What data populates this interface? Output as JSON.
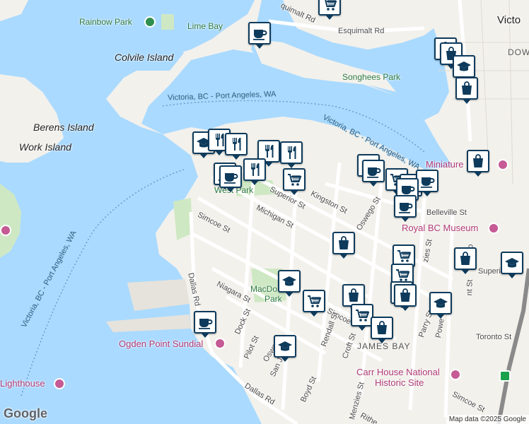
{
  "map": {
    "places": {
      "colvile": "Colvile Island",
      "berens": "Berens Island",
      "work": "Work Island",
      "victoria": "Victo",
      "downtown": "DOW",
      "james_bay": "JAMES BAY"
    },
    "parks": {
      "rainbow": "Rainbow Park",
      "lime_bay": "Lime Bay",
      "songhees": "Songhees Park",
      "west_park": "West Park",
      "macdonald": "MacDo",
      "macdonald2": "Park"
    },
    "pois": {
      "miniature": "Miniature",
      "royal_bc": "Royal BC Museum",
      "ogden": "Ogden Point Sundial",
      "carr_house_1": "Carr House National",
      "carr_house_2": "Historic Site",
      "lighthouse": "Lighthouse"
    },
    "water": {
      "route_top": "Victoria, BC - Port Angeles, WA",
      "route_right": "Victoria, BC - Port Angeles, WA",
      "route_left": "Victoria, BC - Port Angeles, WA"
    },
    "streets": {
      "esquimalt_rd": "Esquimalt Rd",
      "esquimalt_top": "quimalt Rd",
      "superior": "Superior St",
      "superior_right": "Superi",
      "kingston": "Kingston St",
      "oswego": "Oswego St",
      "oswego2": "Oswego",
      "belleville": "Belleville St",
      "michigan": "Michigan St",
      "simcoe": "Simcoe St",
      "simcoe2": "Simcoe",
      "simcoe3": "Simcoe St",
      "niagara": "Niagara St",
      "dallas": "Dallas Rd",
      "dallas2": "Dallas Rd",
      "dock": "Dock St",
      "pilot": "Pilot St",
      "san_j": "San J",
      "boyd": "Boyd St",
      "rendall": "Rendall St",
      "croft": "Croft St",
      "parry": "Parry St",
      "power": "Powe",
      "toronto": "Toronto St",
      "menzies": "Menzies St",
      "menzies_top": "zies St",
      "gov": "Go",
      "gov2": "nt St",
      "rithet": "Rithe"
    },
    "footer": {
      "google": "Google",
      "attribution": "Map data ©2025 Google"
    },
    "colors": {
      "water": "#aadaff",
      "land": "#f3f1ec",
      "park": "#cfe8c4",
      "marker_border": "#0e3b5c"
    }
  }
}
